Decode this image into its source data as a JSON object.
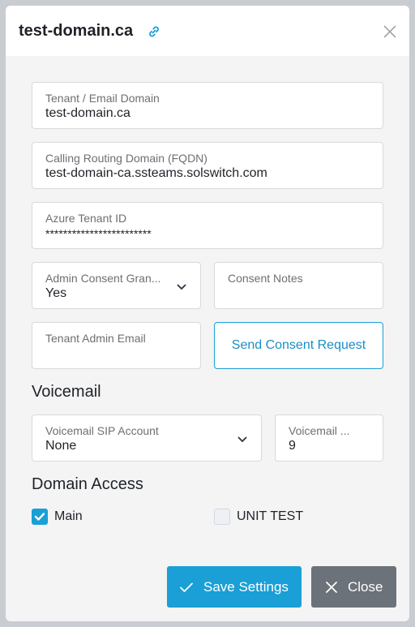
{
  "header": {
    "title": "test-domain.ca",
    "link_icon": "link-icon",
    "close_icon": "close-icon"
  },
  "fields": {
    "tenant_domain": {
      "label": "Tenant / Email Domain",
      "value": "test-domain.ca"
    },
    "routing_domain": {
      "label": "Calling Routing Domain (FQDN)",
      "value": "test-domain-ca.ssteams.solswitch.com"
    },
    "azure_tenant": {
      "label": "Azure Tenant ID",
      "value": "************************"
    },
    "admin_consent": {
      "label": "Admin Consent Gran...",
      "value": "Yes"
    },
    "consent_notes": {
      "label": "Consent Notes",
      "value": ""
    },
    "admin_email": {
      "label": "Tenant Admin Email",
      "value": ""
    }
  },
  "send_consent_label": "Send Consent Request",
  "voicemail": {
    "title": "Voicemail",
    "sip_account": {
      "label": "Voicemail SIP Account",
      "value": "None"
    },
    "other": {
      "label": "Voicemail ...",
      "value": "9"
    }
  },
  "domain_access": {
    "title": "Domain Access",
    "items": [
      {
        "label": "Main",
        "checked": true
      },
      {
        "label": "UNIT TEST",
        "checked": false
      }
    ]
  },
  "footer": {
    "save_label": "Save Settings",
    "close_label": "Close"
  },
  "colors": {
    "accent": "#1a9fd6",
    "close_button": "#6c727a"
  }
}
